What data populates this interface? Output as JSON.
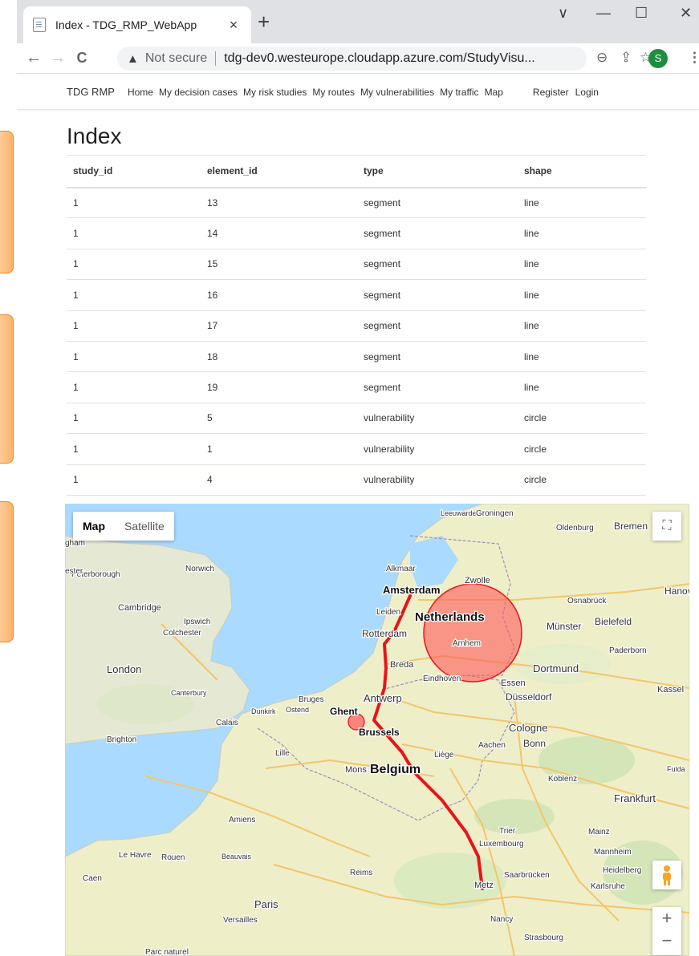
{
  "browser": {
    "tab_title": "Index - TDG_RMP_WebApp",
    "tab_close": "×",
    "new_tab": "+",
    "minimize": "—",
    "maximize": "☐",
    "close": "✕",
    "dropdown": "∨",
    "back": "←",
    "forward": "→",
    "reload": "C",
    "not_secure": "Not secure",
    "url": "tdg-dev0.westeurope.cloudapp.azure.com/StudyVisu...",
    "profile_initial": "S"
  },
  "site_nav": {
    "brand": "TDG RMP",
    "links": [
      "Home",
      "My decision cases",
      "My risk studies",
      "My routes",
      "My vulnerabilities",
      "My traffic",
      "Map"
    ],
    "register": "Register",
    "login": "Login"
  },
  "page": {
    "title": "Index"
  },
  "table": {
    "headers": [
      "study_id",
      "element_id",
      "type",
      "shape"
    ],
    "rows": [
      [
        "1",
        "13",
        "segment",
        "line"
      ],
      [
        "1",
        "14",
        "segment",
        "line"
      ],
      [
        "1",
        "15",
        "segment",
        "line"
      ],
      [
        "1",
        "16",
        "segment",
        "line"
      ],
      [
        "1",
        "17",
        "segment",
        "line"
      ],
      [
        "1",
        "18",
        "segment",
        "line"
      ],
      [
        "1",
        "19",
        "segment",
        "line"
      ],
      [
        "1",
        "5",
        "vulnerability",
        "circle"
      ],
      [
        "1",
        "1",
        "vulnerability",
        "circle"
      ],
      [
        "1",
        "4",
        "vulnerability",
        "circle"
      ]
    ]
  },
  "map": {
    "type_map": "Map",
    "type_satellite": "Satellite",
    "zoom_in": "+",
    "zoom_out": "−",
    "route_color": "#e8141a",
    "circle_color": "#ff5a5a",
    "countries": [
      {
        "name": "Netherlands"
      },
      {
        "name": "Belgium"
      }
    ],
    "cities": [
      {
        "name": "Leeuwarden"
      },
      {
        "name": "Groningen"
      },
      {
        "name": "Oldenburg"
      },
      {
        "name": "Bremen"
      },
      {
        "name": "Peterborough"
      },
      {
        "name": "Norwich"
      },
      {
        "name": "Alkmaar"
      },
      {
        "name": "Zwolle"
      },
      {
        "name": "Amsterdam"
      },
      {
        "name": "Leiden"
      },
      {
        "name": "Osnabrück"
      },
      {
        "name": "Hanov"
      },
      {
        "name": "Cambridge"
      },
      {
        "name": "Ipswich"
      },
      {
        "name": "Colchester"
      },
      {
        "name": "Rotterdam"
      },
      {
        "name": "Arnhem"
      },
      {
        "name": "Münster"
      },
      {
        "name": "Bielefeld"
      },
      {
        "name": "Paderborn"
      },
      {
        "name": "London"
      },
      {
        "name": "Breda"
      },
      {
        "name": "Eindhoven"
      },
      {
        "name": "Dortmund"
      },
      {
        "name": "Essen"
      },
      {
        "name": "Canterbury"
      },
      {
        "name": "Bruges"
      },
      {
        "name": "Antwerp"
      },
      {
        "name": "Düsseldorf"
      },
      {
        "name": "Kassel"
      },
      {
        "name": "Dunkirk"
      },
      {
        "name": "Ostend"
      },
      {
        "name": "Ghent"
      },
      {
        "name": "Calais"
      },
      {
        "name": "Brighton"
      },
      {
        "name": "Brussels"
      },
      {
        "name": "Cologne"
      },
      {
        "name": "Aachen"
      },
      {
        "name": "Bonn"
      },
      {
        "name": "Lille"
      },
      {
        "name": "Liège"
      },
      {
        "name": "Mons"
      },
      {
        "name": "Koblenz"
      },
      {
        "name": "Fulda"
      },
      {
        "name": "Frankfurt"
      },
      {
        "name": "Amiens"
      },
      {
        "name": "Trier"
      },
      {
        "name": "Mainz"
      },
      {
        "name": "Luxembourg"
      },
      {
        "name": "Le Havre"
      },
      {
        "name": "Rouen"
      },
      {
        "name": "Beauvais"
      },
      {
        "name": "Mannheim"
      },
      {
        "name": "Caen"
      },
      {
        "name": "Reims"
      },
      {
        "name": "Saarbrücken"
      },
      {
        "name": "Heidelberg"
      },
      {
        "name": "Heilbr"
      },
      {
        "name": "Metz"
      },
      {
        "name": "Karlsruhe"
      },
      {
        "name": "Paris"
      },
      {
        "name": "Stuttg"
      },
      {
        "name": "Versailles"
      },
      {
        "name": "Nancy"
      },
      {
        "name": "Strasbourg"
      },
      {
        "name": "Parc naturel"
      },
      {
        "name": "gham"
      },
      {
        "name": "ester"
      }
    ]
  }
}
